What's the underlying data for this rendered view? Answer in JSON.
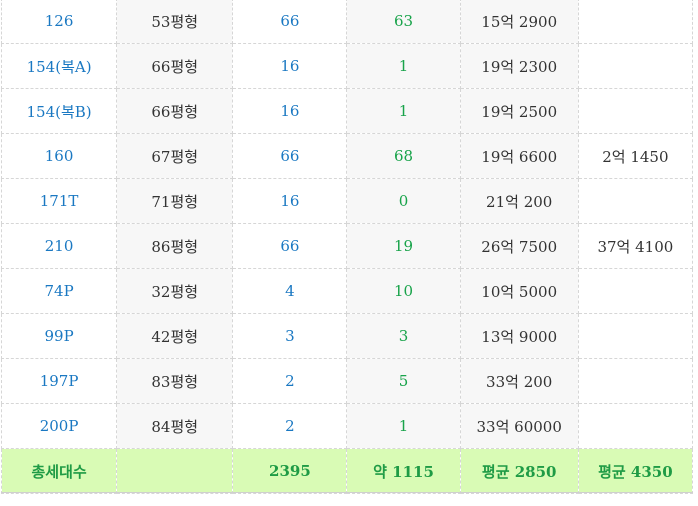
{
  "rows": [
    {
      "type": "126",
      "size": "53평형",
      "units": "66",
      "count": "63",
      "price": "15억 2900",
      "extra": ""
    },
    {
      "type": "154(복A)",
      "size": "66평형",
      "units": "16",
      "count": "1",
      "price": "19억 2300",
      "extra": ""
    },
    {
      "type": "154(복B)",
      "size": "66평형",
      "units": "16",
      "count": "1",
      "price": "19억 2500",
      "extra": ""
    },
    {
      "type": "160",
      "size": "67평형",
      "units": "66",
      "count": "68",
      "price": "19억 6600",
      "extra": "2억 1450"
    },
    {
      "type": "171T",
      "size": "71평형",
      "units": "16",
      "count": "0",
      "price": "21억 200",
      "extra": ""
    },
    {
      "type": "210",
      "size": "86평형",
      "units": "66",
      "count": "19",
      "price": "26억 7500",
      "extra": "37억 4100"
    },
    {
      "type": "74P",
      "size": "32평형",
      "units": "4",
      "count": "10",
      "price": "10억 5000",
      "extra": ""
    },
    {
      "type": "99P",
      "size": "42평형",
      "units": "3",
      "count": "3",
      "price": "13억 9000",
      "extra": ""
    },
    {
      "type": "197P",
      "size": "83평형",
      "units": "2",
      "count": "5",
      "price": "33억 200",
      "extra": ""
    },
    {
      "type": "200P",
      "size": "84평형",
      "units": "2",
      "count": "1",
      "price": "33억 60000",
      "extra": ""
    }
  ],
  "total": {
    "label": "총세대수",
    "size": "",
    "units": "2395",
    "count": "약 1115",
    "price": "평균 2850",
    "extra": "평균 4350"
  },
  "colors": {
    "type_text": "#1a78c2",
    "count_text": "#18a34a",
    "total_bg": "#d9fbb5",
    "total_text": "#1f9b45"
  }
}
